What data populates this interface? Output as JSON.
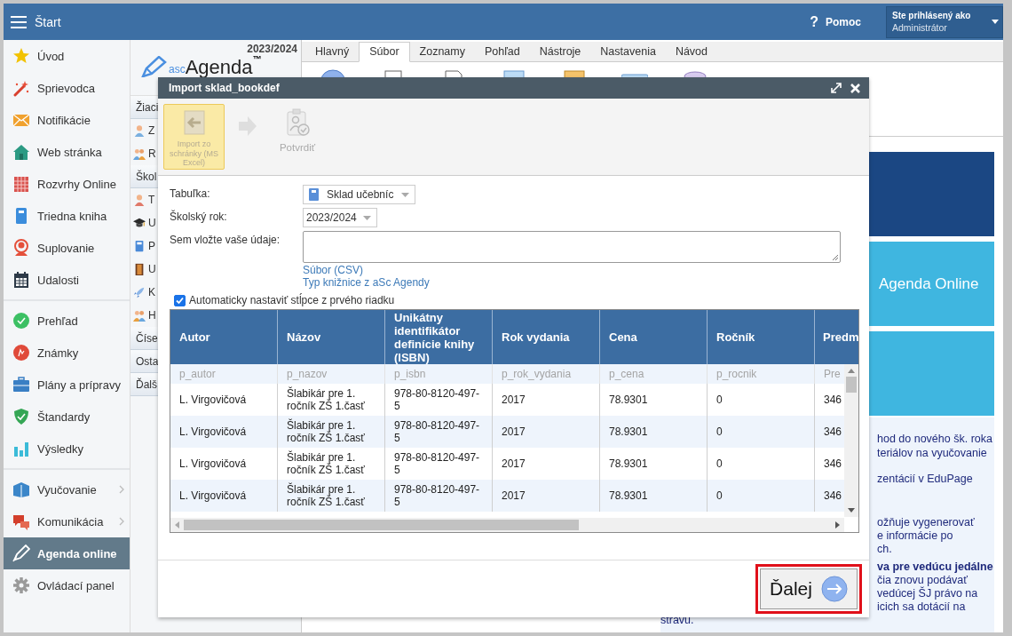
{
  "topbar": {
    "title": "Štart",
    "help_icon": "?",
    "help": "Pomoc",
    "user_label": "Ste prihlásený ako",
    "user": "Administrátor"
  },
  "sidebar": {
    "groups": [
      [
        {
          "label": "Úvod",
          "selected": false,
          "submenu": false
        },
        {
          "label": "Sprievodca",
          "selected": false,
          "submenu": false
        },
        {
          "label": "Notifikácie",
          "selected": false,
          "submenu": false
        },
        {
          "label": "Web stránka",
          "selected": false,
          "submenu": false
        },
        {
          "label": "Rozvrhy Online",
          "selected": false,
          "submenu": false
        },
        {
          "label": "Triedna kniha",
          "selected": false,
          "submenu": false
        },
        {
          "label": "Suplovanie",
          "selected": false,
          "submenu": false
        },
        {
          "label": "Udalosti",
          "selected": false,
          "submenu": false
        }
      ],
      [
        {
          "label": "Prehľad",
          "selected": false,
          "submenu": false
        },
        {
          "label": "Známky",
          "selected": false,
          "submenu": false
        },
        {
          "label": "Plány a prípravy",
          "selected": false,
          "submenu": false
        },
        {
          "label": "Štandardy",
          "selected": false,
          "submenu": false
        },
        {
          "label": "Výsledky",
          "selected": false,
          "submenu": false
        }
      ],
      [
        {
          "label": "Vyučovanie",
          "selected": false,
          "submenu": true
        },
        {
          "label": "Komunikácia",
          "selected": false,
          "submenu": true
        },
        {
          "label": "Agenda online",
          "selected": true,
          "submenu": false
        },
        {
          "label": "Ovládací panel",
          "selected": false,
          "submenu": false
        }
      ]
    ]
  },
  "module_panel": {
    "year": "2023/2024",
    "logo": {
      "prefix": "asc",
      "name": "Agenda",
      "mark": "™"
    },
    "items": [
      {
        "kind": "header",
        "label": "Žiaci"
      },
      {
        "kind": "item",
        "label": "Z"
      },
      {
        "kind": "item",
        "label": "R"
      },
      {
        "kind": "header",
        "label": "Škol"
      },
      {
        "kind": "item",
        "label": "T"
      },
      {
        "kind": "item",
        "label": "U"
      },
      {
        "kind": "item",
        "label": "P"
      },
      {
        "kind": "item",
        "label": "U"
      },
      {
        "kind": "item",
        "label": "K"
      },
      {
        "kind": "item",
        "label": "H"
      },
      {
        "kind": "header",
        "label": "Číse"
      },
      {
        "kind": "header",
        "label": "Osta"
      },
      {
        "kind": "header",
        "label": "Ďalš"
      }
    ]
  },
  "ribbon": {
    "tabs": [
      {
        "label": "Hlavný",
        "selected": false
      },
      {
        "label": "Súbor",
        "selected": true
      },
      {
        "label": "Zoznamy",
        "selected": false
      },
      {
        "label": "Pohľad",
        "selected": false
      },
      {
        "label": "Nástroje",
        "selected": false
      },
      {
        "label": "Nastavenia",
        "selected": false
      },
      {
        "label": "Návod",
        "selected": false
      }
    ]
  },
  "tiles": [
    {
      "color": "#1b4783"
    },
    {
      "color": "#3fb6e0",
      "label": "Agenda Online"
    },
    {
      "color": "#3fb6e0"
    }
  ],
  "news": [
    {
      "kind": "clipped",
      "lines": [
        {
          "text": "hod do nového šk. roka",
          "bold": false
        },
        {
          "text": "teriálov na vyučovanie",
          "bold": false
        }
      ]
    },
    {
      "kind": "clipped",
      "lines": [
        {
          "text": "zentácií v EduPage",
          "bold": false
        }
      ]
    },
    {
      "kind": "clipped",
      "lines": [
        {
          "text": "ožňuje vygenerovať",
          "bold": false
        },
        {
          "text": "e informácie po",
          "bold": false
        },
        {
          "text": "ch.",
          "bold": false
        }
      ]
    },
    {
      "kind": "clipped",
      "lines": [
        {
          "text": "va pre vedúcu jedálne",
          "bold": true
        },
        {
          "text": "čia znovu podávať",
          "bold": false
        },
        {
          "text": "vedúcej ŠJ právo na",
          "bold": false
        },
        {
          "text": "icich sa dotácií na",
          "bold": false
        }
      ]
    },
    {
      "kind": "full",
      "lines": [
        {
          "text": "stravu.",
          "bold": false
        }
      ]
    }
  ],
  "dialog": {
    "title": "Import sklad_bookdef",
    "steps": [
      {
        "kind": "import",
        "label": "Import zo schránky (MS Excel)",
        "selected": true
      },
      {
        "kind": "arrow"
      },
      {
        "kind": "confirm",
        "label": "Potvrdiť",
        "selected": false
      }
    ],
    "fields": [
      {
        "kind": "table_select",
        "label": "Tabuľka:",
        "value": "Sklad učebníc"
      },
      {
        "kind": "select",
        "label": "Školský rok:",
        "value": "2023/2024"
      },
      {
        "kind": "textarea",
        "label": "Sem vložte vaše údaje:"
      }
    ],
    "links": [
      "Súbor (CSV)",
      "Typ knižnice z aSc Agendy"
    ],
    "auto_columns": {
      "label": "Automaticky nastaviť stĺpce z prvého riadku",
      "checked": true
    },
    "table": {
      "columns": [
        {
          "label": "Autor",
          "hint": "p_autor"
        },
        {
          "label": "Názov",
          "hint": "p_nazov"
        },
        {
          "label": "Unikátny identifikátor definície knihy (ISBN)",
          "hint": "p_isbn"
        },
        {
          "label": "Rok vydania",
          "hint": "p_rok_vydania"
        },
        {
          "label": "Cena",
          "hint": "p_cena"
        },
        {
          "label": "Ročník",
          "hint": "p_rocnik"
        },
        {
          "label": "Predm",
          "hint": "Pre"
        }
      ],
      "rows": [
        [
          "L. Virgovičová",
          "Šlabikár pre 1. ročník ZŠ 1.časť",
          "978-80-8120-497-5",
          "2017",
          "78.9301",
          "0",
          "346"
        ],
        [
          "L. Virgovičová",
          "Šlabikár pre 1. ročník ZŠ 1.časť",
          "978-80-8120-497-5",
          "2017",
          "78.9301",
          "0",
          "346"
        ],
        [
          "L. Virgovičová",
          "Šlabikár pre 1. ročník ZŠ 1.časť",
          "978-80-8120-497-5",
          "2017",
          "78.9301",
          "0",
          "346"
        ],
        [
          "L. Virgovičová",
          "Šlabikár pre 1. ročník ZŠ 1.časť",
          "978-80-8120-497-5",
          "2017",
          "78.9301",
          "0",
          "346"
        ]
      ]
    },
    "next_button": "Ďalej"
  }
}
